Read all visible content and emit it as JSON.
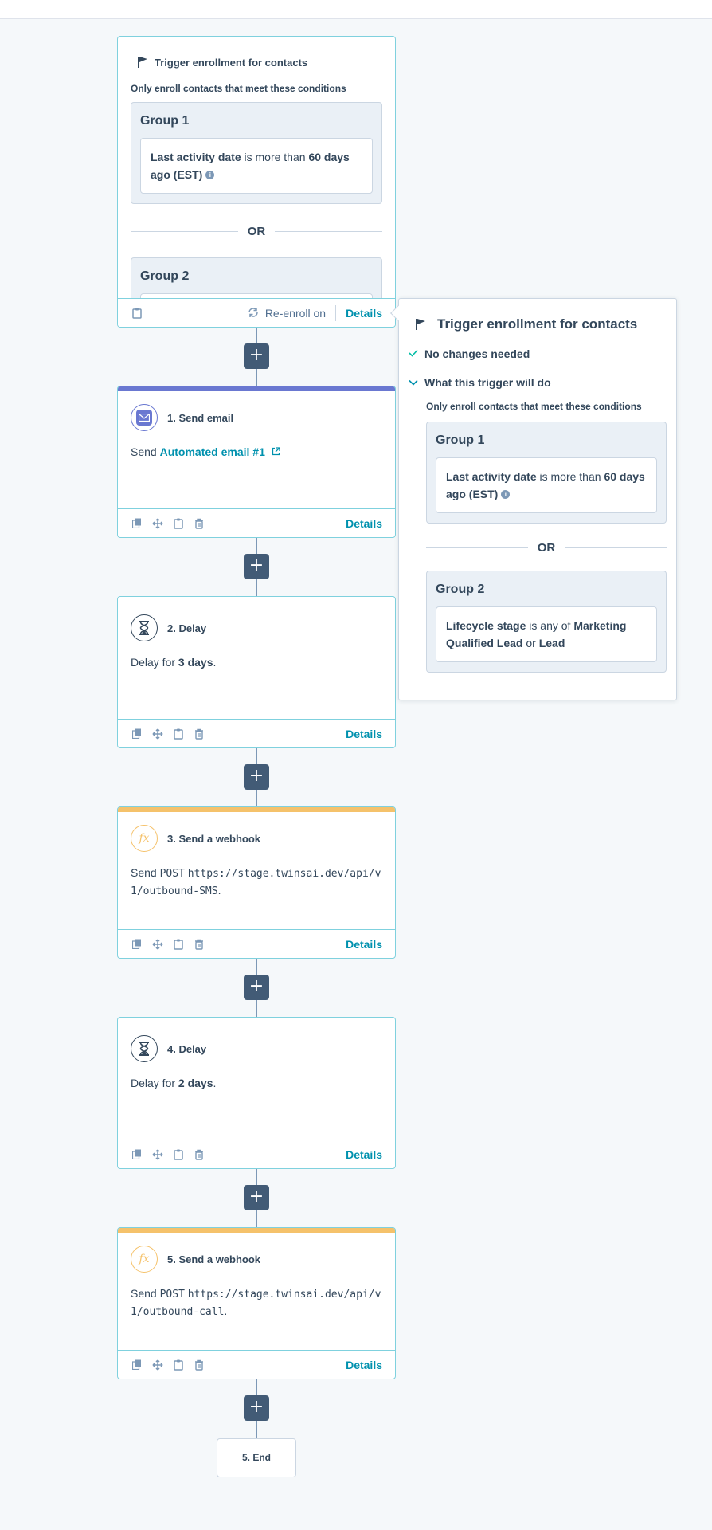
{
  "trigger": {
    "title": "Trigger enrollment for contacts",
    "subtitle": "Only enroll contacts that meet these conditions",
    "group1_title": "Group 1",
    "group1_cond": {
      "field": "Last activity date",
      "op": " is more than ",
      "value": "60 days ago (EST)"
    },
    "or_label": "OR",
    "group2_title": "Group 2",
    "reenroll_label": "Re-enroll on",
    "details_label": "Details"
  },
  "popover": {
    "title": "Trigger enrollment for contacts",
    "status": "No changes needed",
    "expand_label": "What this trigger will do",
    "subtitle": "Only enroll contacts that meet these conditions",
    "group1_title": "Group 1",
    "group1_cond": {
      "field": "Last activity date",
      "op": " is more than ",
      "value": "60 days ago (EST)"
    },
    "or_label": "OR",
    "group2_title": "Group 2",
    "group2_cond": {
      "field": "Lifecycle stage",
      "op": " is any of ",
      "value1": "Marketing Qualified Lead",
      "joiner": " or ",
      "value2": "Lead"
    }
  },
  "steps": [
    {
      "title": "1. Send email",
      "prefix": "Send ",
      "link": "Automated email #1",
      "details": "Details",
      "accent": "#6a78d1"
    },
    {
      "title": "2. Delay",
      "prefix": "Delay for ",
      "strong": "3 days",
      "suffix": ".",
      "details": "Details"
    },
    {
      "title": "3. Send a webhook",
      "prefix": "Send ",
      "method": "POST",
      "url": "https://stage.twinsai.dev/api/v1/outbound-SMS",
      "suffix": ".",
      "details": "Details",
      "accent": "#f5c26b"
    },
    {
      "title": "4. Delay",
      "prefix": "Delay for ",
      "strong": "2 days",
      "suffix": ".",
      "details": "Details"
    },
    {
      "title": "5. Send a webhook",
      "prefix": "Send ",
      "method": "POST",
      "url": "https://stage.twinsai.dev/api/v1/outbound-call",
      "suffix": ".",
      "details": "Details",
      "accent": "#f5c26b"
    }
  ],
  "plus_label": "+",
  "end_label": "5. End",
  "icons": [
    "flag-icon",
    "clipboard-icon",
    "refresh-icon",
    "email-icon",
    "external-link-icon",
    "copy-icon",
    "move-icon",
    "trash-icon",
    "hourglass-icon",
    "fx-icon",
    "check-icon",
    "chevron-down-icon",
    "info-icon"
  ],
  "colors": {
    "teal_link": "#0091ae",
    "card_border": "#7fd1de",
    "plus_bg": "#425b76",
    "email_accent": "#6a78d1",
    "webhook_accent": "#f5c26b"
  }
}
